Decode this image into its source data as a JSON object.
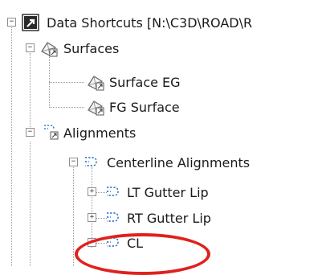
{
  "tree": {
    "root": {
      "label": "Data Shortcuts [N:\\C3D\\ROAD\\R",
      "icon": "shortcut-arrow-icon",
      "expanded": true
    },
    "surfaces": {
      "label": "Surfaces",
      "icon": "surface-folder-icon",
      "expanded": true,
      "items": [
        {
          "label": "Surface EG",
          "icon": "surface-icon"
        },
        {
          "label": "FG Surface",
          "icon": "surface-icon"
        }
      ]
    },
    "alignments": {
      "label": "Alignments",
      "icon": "alignment-folder-icon",
      "expanded": true,
      "groups": [
        {
          "label": "Centerline Alignments",
          "icon": "alignment-icon",
          "expanded": true,
          "items": [
            {
              "label": "LT Gutter Lip",
              "icon": "alignment-icon",
              "expanded": false
            },
            {
              "label": "RT Gutter Lip",
              "icon": "alignment-icon",
              "expanded": false
            },
            {
              "label": "CL",
              "icon": "alignment-icon",
              "expanded": false,
              "highlighted": true
            }
          ]
        }
      ]
    }
  },
  "highlight": {
    "color": "#e0211d",
    "target": "CL"
  }
}
